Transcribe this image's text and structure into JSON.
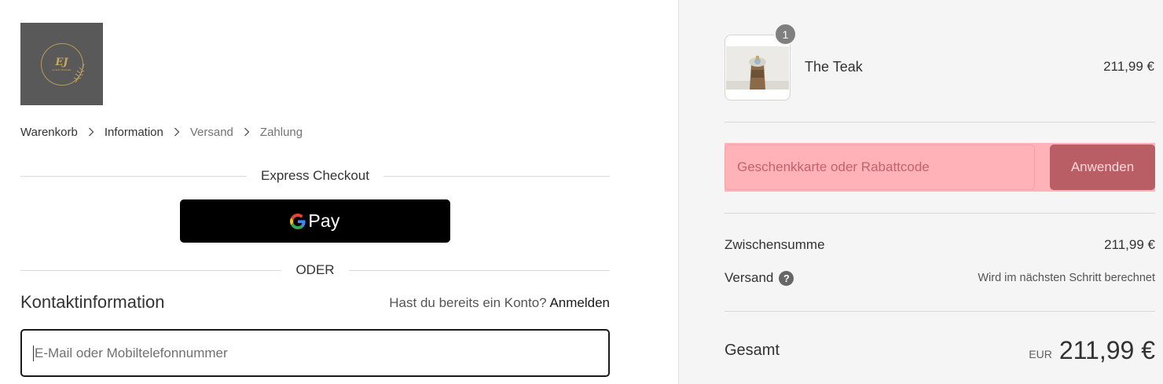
{
  "logo": {
    "monogram": "EJ",
    "subtitle": "EVERYWHERE"
  },
  "breadcrumb": [
    {
      "label": "Warenkorb",
      "state": "active"
    },
    {
      "label": "Information",
      "state": "active"
    },
    {
      "label": "Versand",
      "state": "muted"
    },
    {
      "label": "Zahlung",
      "state": "muted"
    }
  ],
  "express": {
    "title": "Express Checkout",
    "gpay_label": "Pay",
    "or_label": "ODER"
  },
  "contact": {
    "title": "Kontaktinformation",
    "account_prompt": "Hast du bereits ein Konto?",
    "login_link": "Anmelden",
    "email_placeholder": "E-Mail oder Mobiltelefonnummer"
  },
  "cart": {
    "item": {
      "quantity": "1",
      "name": "The Teak",
      "price": "211,99 €"
    },
    "discount": {
      "placeholder": "Geschenkkarte oder Rabattcode",
      "apply_label": "Anwenden"
    },
    "subtotal": {
      "label": "Zwischensumme",
      "value": "211,99 €"
    },
    "shipping": {
      "label": "Versand",
      "value": "Wird im nächsten Schritt berechnet"
    },
    "total": {
      "label": "Gesamt",
      "currency": "EUR",
      "value": "211,99 €"
    }
  },
  "colors": {
    "gpay_background": "#000000",
    "discount_highlight": "#ffb3b8",
    "apply_button": "#b85e64",
    "sidebar_background": "#f5f5f5"
  },
  "icons": [
    "chevron-right-icon",
    "google-g-icon",
    "help-icon"
  ]
}
